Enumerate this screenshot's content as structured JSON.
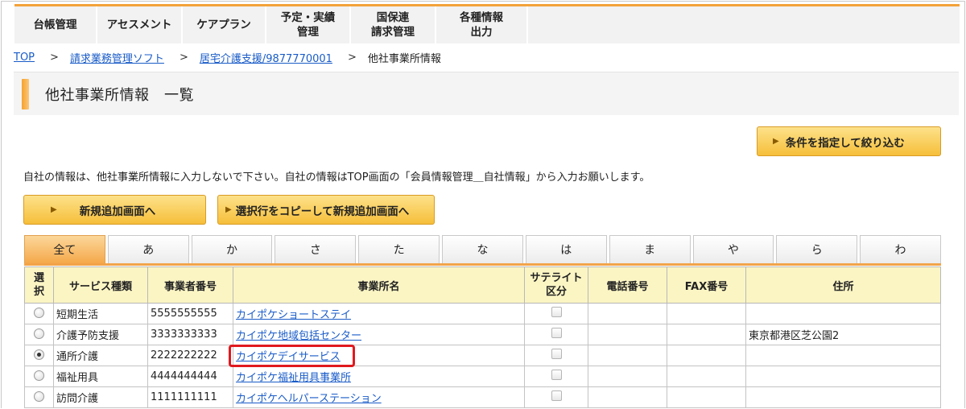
{
  "nav": {
    "items": [
      {
        "label": "台帳管理",
        "name": "nav-ledger"
      },
      {
        "label": "アセスメント",
        "name": "nav-assessment"
      },
      {
        "label": "ケアプラン",
        "name": "nav-careplan"
      },
      {
        "label": "予定・実績\n管理",
        "name": "nav-schedule"
      },
      {
        "label": "国保連\n請求管理",
        "name": "nav-billing"
      },
      {
        "label": "各種情報\n出力",
        "name": "nav-output"
      }
    ]
  },
  "breadcrumb": {
    "top": "TOP",
    "sep": ">",
    "billing_soft": "請求業務管理ソフト",
    "home_care": "居宅介護支援/9877770001",
    "current": "他社事業所情報"
  },
  "page_title": "他社事業所情報　一覧",
  "buttons": {
    "filter": "条件を指定して絞り込む",
    "add_new": "新規追加画面へ",
    "copy_add": "選択行をコピーして新規追加画面へ",
    "arrow": "▶"
  },
  "notice": "自社の情報は、他社事業所情報に入力しないで下さい。自社の情報はTOP画面の「会員情報管理＿自社情報」から入力お願いします。",
  "tabs": [
    "全て",
    "あ",
    "か",
    "さ",
    "た",
    "な",
    "は",
    "ま",
    "や",
    "ら",
    "わ"
  ],
  "active_tab": "全て",
  "table": {
    "headers": {
      "select": "選\n択",
      "service": "サービス種類",
      "provider_no": "事業者番号",
      "office_name": "事業所名",
      "satellite": "サテライト\n区分",
      "phone": "電話番号",
      "fax": "FAX番号",
      "address": "住所"
    },
    "rows": [
      {
        "selected": false,
        "service": "短期生活",
        "provider_no": "5555555555",
        "office_name": "カイポケショートステイ",
        "satellite": false,
        "phone": "",
        "fax": "",
        "address": ""
      },
      {
        "selected": false,
        "service": "介護予防支援",
        "provider_no": "3333333333",
        "office_name": "カイポケ地域包括センター",
        "satellite": false,
        "phone": "",
        "fax": "",
        "address": "東京都港区芝公園2"
      },
      {
        "selected": true,
        "service": "通所介護",
        "provider_no": "2222222222",
        "office_name": "カイポケデイサービス",
        "satellite": false,
        "phone": "",
        "fax": "",
        "address": ""
      },
      {
        "selected": false,
        "service": "福祉用具",
        "provider_no": "4444444444",
        "office_name": "カイポケ福祉用具事業所",
        "satellite": false,
        "phone": "",
        "fax": "",
        "address": ""
      },
      {
        "selected": false,
        "service": "訪問介護",
        "provider_no": "1111111111",
        "office_name": "カイポケヘルパーステーション",
        "satellite": false,
        "phone": "",
        "fax": "",
        "address": ""
      }
    ]
  },
  "colors": {
    "accent_orange": "#f3a23a",
    "header_yellow": "#fbf5c4",
    "link_blue": "#1a5cc8",
    "highlight_red": "#e0191e"
  }
}
